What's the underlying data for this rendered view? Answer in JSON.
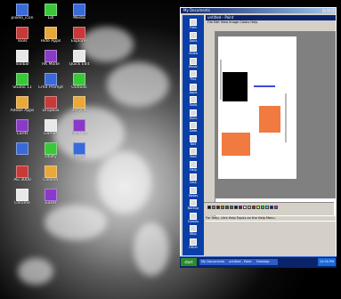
{
  "desktop": {
    "icons": [
      {
        "label": "pixelo_icon",
        "icon": "app-icon"
      },
      {
        "label": "Tools",
        "icon": "tools-icon"
      },
      {
        "label": "Toolbar",
        "icon": "toolbar-icon"
      },
      {
        "label": "Studio 11",
        "icon": "studio-icon"
      },
      {
        "label": "Adobe Apps",
        "icon": "adobe-icon"
      },
      {
        "label": "Cards",
        "icon": "cards-icon"
      },
      {
        "label": "",
        "icon": "gear-icon"
      },
      {
        "label": "AG 3000",
        "icon": "app-icon"
      },
      {
        "label": "Chrome",
        "icon": "browser-icon"
      },
      {
        "label": "Lib",
        "icon": "folder-icon"
      },
      {
        "label": "Hide Apps",
        "icon": "app-icon"
      },
      {
        "label": "RK Mode",
        "icon": "app-icon"
      },
      {
        "label": "Cmd Prompt",
        "icon": "terminal-icon"
      },
      {
        "label": "Dropbox",
        "icon": "dropbox-icon"
      },
      {
        "label": "Games",
        "icon": "game-icon"
      },
      {
        "label": "Utility",
        "icon": "app-icon"
      },
      {
        "label": "Cleaner",
        "icon": "app-icon"
      },
      {
        "label": "Excel",
        "icon": "excel-icon"
      },
      {
        "label": "Media",
        "icon": "media-icon"
      },
      {
        "label": "Explorer",
        "icon": "folder-icon"
      },
      {
        "label": "Quick Edit",
        "icon": "app-icon"
      },
      {
        "label": "Outlook",
        "icon": "mail-icon"
      },
      {
        "label": "Recycle",
        "icon": "recycle-icon"
      },
      {
        "label": "Internet",
        "icon": "browser-icon"
      },
      {
        "label": "Player",
        "icon": "media-icon"
      }
    ]
  },
  "window": {
    "title": "My Documents",
    "sidebar_items": [
      "Files",
      "Docs",
      "Video",
      "Music",
      "Pics",
      "Apps",
      "Tools",
      "Docs",
      "Data",
      "Net",
      "Mail",
      "Help",
      "Disk",
      "Notes",
      "Backup",
      "Games",
      "Misc",
      "Other"
    ],
    "paint": {
      "title": "untitled - Paint",
      "menu": "File  Edit  View  Image  Colors  Help",
      "status": "For Help, click Help Topics on the Help Menu."
    },
    "palette_colors": [
      "#000000",
      "#808080",
      "#800000",
      "#808000",
      "#008000",
      "#008080",
      "#000080",
      "#800080",
      "#ffffff",
      "#c0c0c0",
      "#ff0000",
      "#ffff00",
      "#00ff00",
      "#00ffff",
      "#0000ff",
      "#ff00ff"
    ]
  },
  "taskbar": {
    "start_label": "start",
    "buttons": [
      "My Documents",
      "untitled - Paint",
      "Desktop"
    ],
    "clock": "12:00 PM"
  },
  "colors": {
    "shape_orange": "#f07a40",
    "shape_black": "#000000",
    "line_blue": "#3a4ad8"
  }
}
